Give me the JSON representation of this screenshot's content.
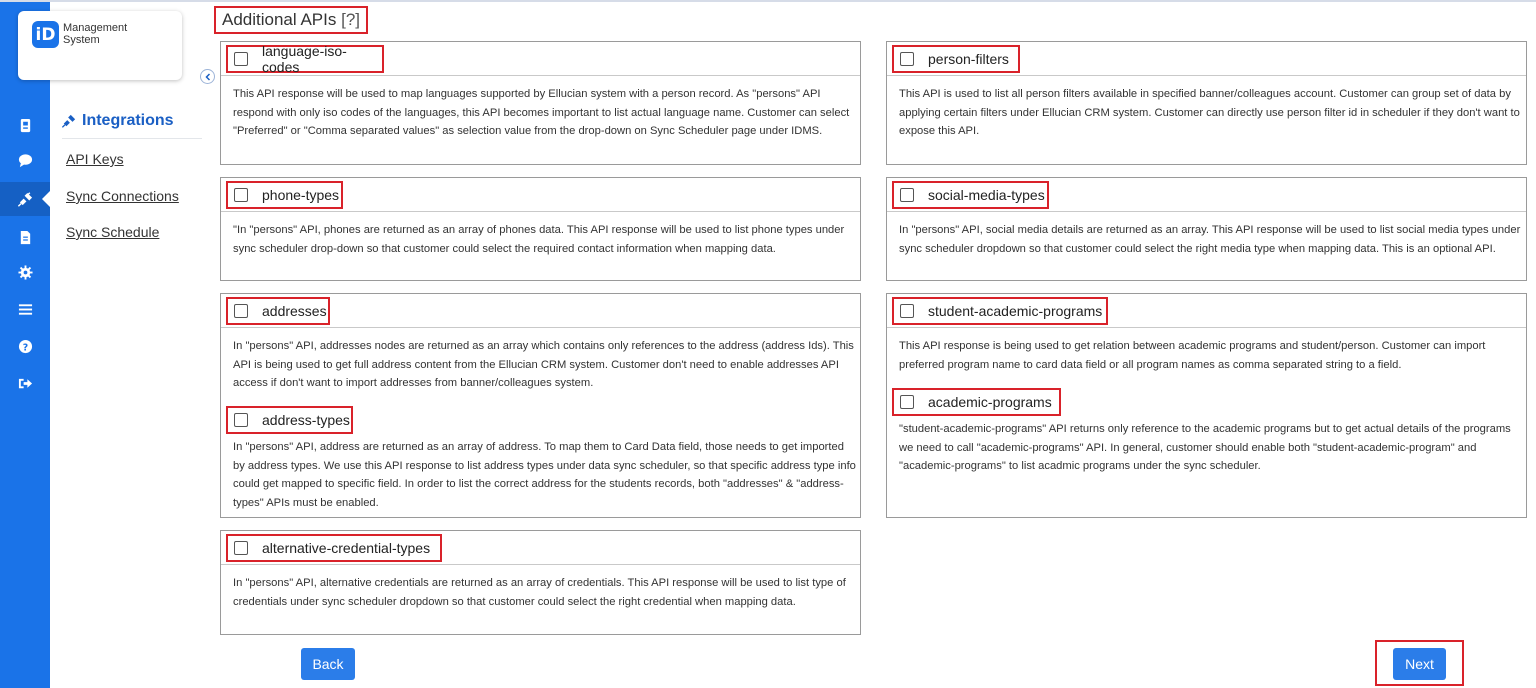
{
  "app": {
    "logo_badge": "iD",
    "logo_line1": "Management",
    "logo_line2": "System"
  },
  "nav": {
    "section_title": "Integrations",
    "links": [
      "API Keys",
      "Sync Connections",
      "Sync Schedule"
    ],
    "rail_icons": [
      "address-card-icon",
      "chat-icon",
      "plug-icon",
      "file-icon",
      "gear-icon",
      "list-icon",
      "help-icon",
      "sign-out-icon"
    ],
    "active_rail_icon": "plug-icon"
  },
  "page": {
    "title": "Additional APIs",
    "help": "[?]"
  },
  "apis": {
    "language_iso_codes": {
      "label": "language-iso-codes",
      "checked": false,
      "desc": "This API response will be used to map languages supported by Ellucian system with a person record. As \"persons\" API respond with only iso codes of the languages, this API becomes important to list actual language name. Customer can select \"Preferred\" or \"Comma separated values\" as selection value from the drop-down on Sync Scheduler page under IDMS."
    },
    "person_filters": {
      "label": "person-filters",
      "checked": false,
      "desc": "This API is used to list all person filters available in specified banner/colleagues account. Customer can group set of data by applying certain filters under Ellucian CRM system. Customer can directly use person filter id in scheduler if they don't want to expose this API."
    },
    "phone_types": {
      "label": "phone-types",
      "checked": false,
      "desc": "\"In \"persons\" API, phones are returned as an array of phones data. This API response will be used to list phone types under sync scheduler drop-down so that customer could select the required contact information when mapping data."
    },
    "social_media_types": {
      "label": "social-media-types",
      "checked": false,
      "desc": "In \"persons\" API, social media details are returned as an array. This API response will be used to list social media types under sync scheduler dropdown so that customer could select the right media type when mapping data. This is an optional API."
    },
    "addresses": {
      "label": "addresses",
      "checked": false,
      "desc": "In \"persons\" API, addresses nodes are returned as an array which contains only references to the address (address Ids). This API is being used to get full address content from the Ellucian CRM system. Customer don't need to enable addresses API access if don't want to import addresses from banner/colleagues system."
    },
    "address_types": {
      "label": "address-types",
      "checked": false,
      "desc": "In \"persons\" API, address are returned as an array of address. To map them to Card Data field, those needs to get imported by address types. We use this API response to list address types under data sync scheduler, so that specific address type info could get mapped to specific field. In order to list the correct address for the students records, both \"addresses\" & \"address-types\" APIs must be enabled."
    },
    "student_academic_programs": {
      "label": "student-academic-programs",
      "checked": false,
      "desc": "This API response is being used to get relation between academic programs and student/person. Customer can import preferred program name to card data field or all program names as comma separated string to a field."
    },
    "academic_programs": {
      "label": "academic-programs",
      "checked": false,
      "desc": "\"student-academic-programs\" API returns only reference to the academic programs but to get actual details of the programs we need to call \"academic-programs\" API. In general, customer should enable both \"student-academic-program\" and \"academic-programs\" to list acadmic programs under the sync scheduler."
    },
    "alternative_credential_types": {
      "label": "alternative-credential-types",
      "checked": false,
      "desc": "In \"persons\" API, alternative credentials are returned as an array of credentials. This API response will be used to list type of credentials under sync scheduler dropdown so that customer could select the right credential when mapping data."
    }
  },
  "buttons": {
    "back": "Back",
    "next": "Next"
  },
  "colors": {
    "primary": "#1a73e8",
    "highlight": "#d9222a",
    "button": "#2b7de9"
  }
}
